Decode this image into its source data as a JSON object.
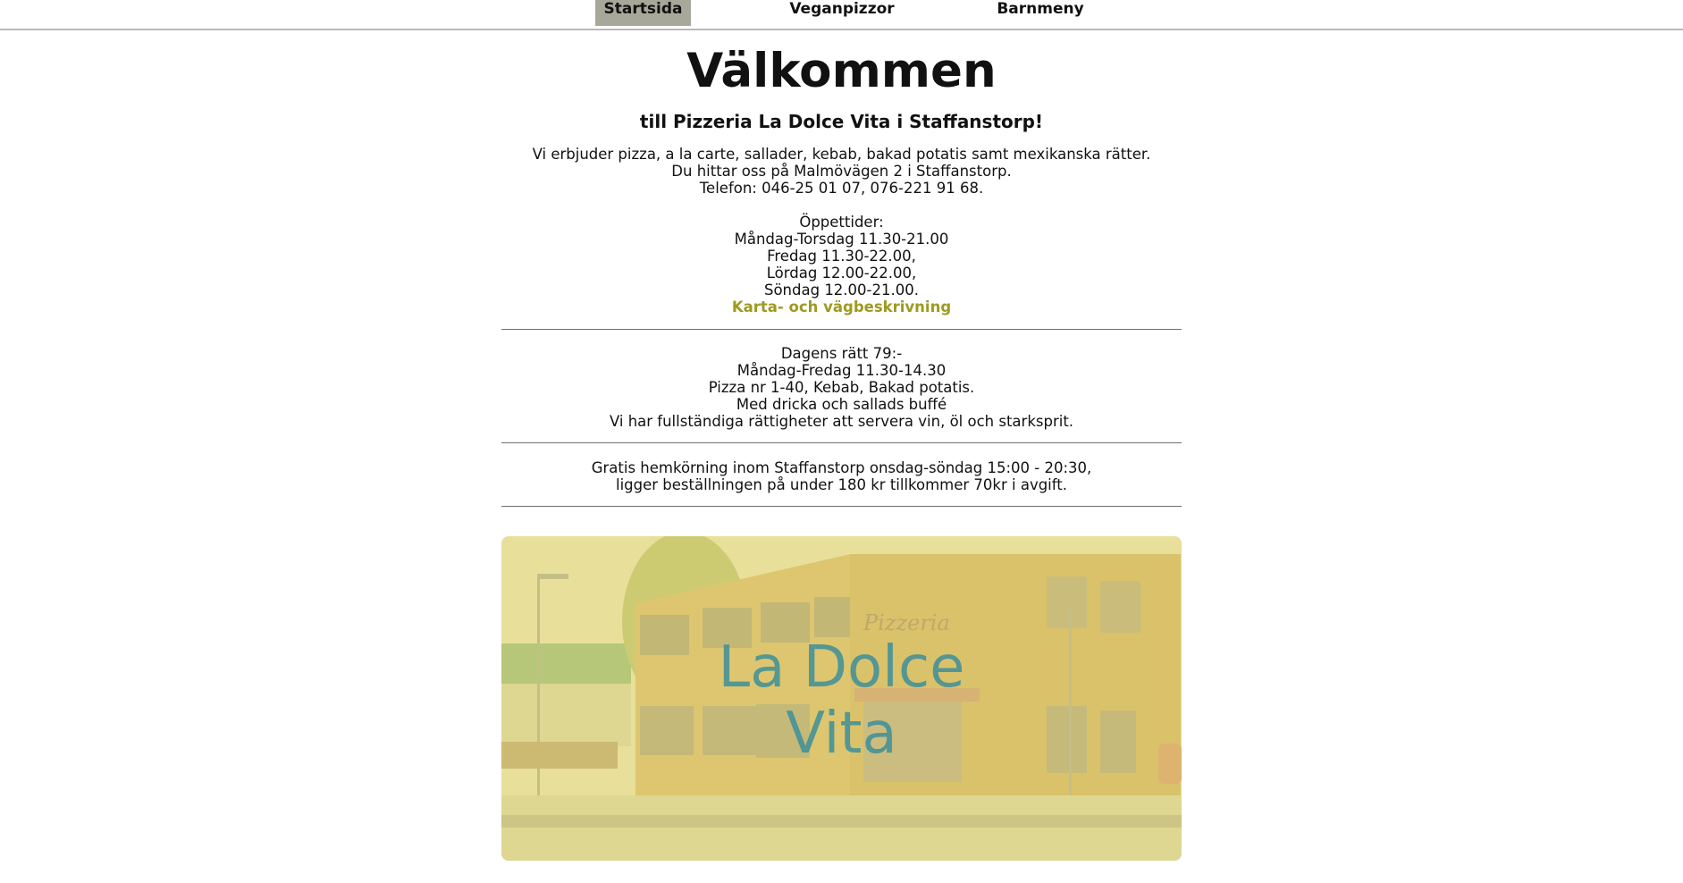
{
  "nav": {
    "items": [
      {
        "label": "Startsida",
        "active": true
      },
      {
        "label": "Veganpizzor",
        "active": false
      },
      {
        "label": "Barnmeny",
        "active": false
      }
    ]
  },
  "heading": "Välkommen",
  "subheading": "till Pizzeria La Dolce Vita i Staffanstorp!",
  "intro": [
    "Vi erbjuder pizza, a la carte, sallader, kebab, bakad potatis samt mexikanska rätter.",
    "Du hittar oss på Malmövägen 2 i Staffanstorp.",
    "Telefon: 046-25 01 07, 076-221 91 68."
  ],
  "hours": {
    "title": "Öppettider:",
    "lines": [
      "Måndag-Torsdag 11.30-21.00",
      "Fredag 11.30-22.00,",
      "Lördag 12.00-22.00,",
      "Söndag 12.00-21.00."
    ],
    "map_link": "Karta- och vägbeskrivning"
  },
  "daily": [
    "Dagens rätt 79:-",
    "Måndag-Fredag 11.30-14.30",
    "Pizza nr 1-40, Kebab, Bakad potatis.",
    "Med dricka och sallads buffé",
    "Vi har fullständiga rättigheter att servera vin, öl och starksprit."
  ],
  "delivery": [
    "Gratis hemkörning inom Staffanstorp onsdag-söndag 15:00 - 20:30,",
    "ligger beställningen på under 180 kr tillkommer 70kr i avgift."
  ],
  "hero": {
    "title_line1": "La Dolce",
    "title_line2": "Vita",
    "sign_text": "Pizzeria",
    "colors": {
      "overlay": "#e6dc7a",
      "wall": "#c9a45a",
      "title": "#3d8f9a"
    }
  }
}
